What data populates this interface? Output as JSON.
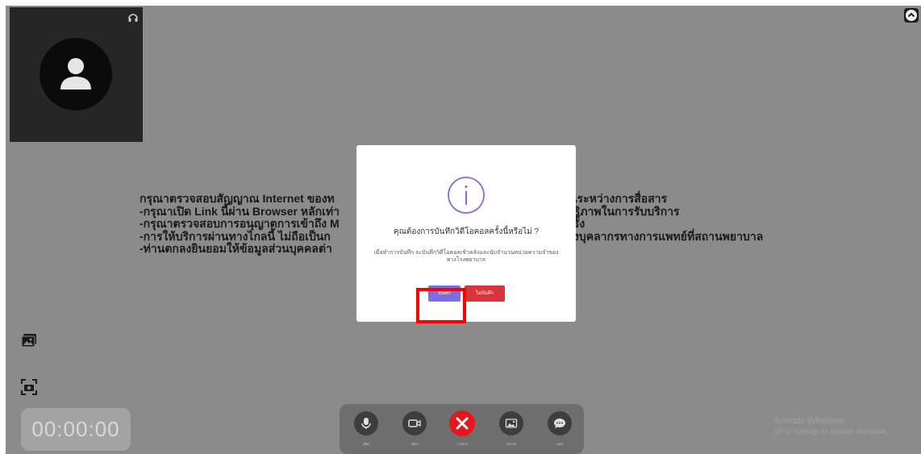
{
  "notice": {
    "lines": [
      "กรุณาตรวจสอบสัญญาณ Internet ของท",
      "-กรุณาเปิด Link นี้ผ่าน Browser หลักเท่า",
      "-กรุณาตรวจสอบการอนุญาตการเข้าถึง M",
      "-การให้บริการผ่านทางไกลนี้ ไม่ถือเป็นก",
      "-ท่านตกลงยินยอมให้ข้อมูลส่วนบุคคลต่า"
    ],
    "right_lines": [
      "เจนระหว่างการสื่อสาร",
      "สิทธิภาพในการรับบริการ",
      "ุกครั้ง",
      "ของบุคลากรทางการแพทย์ที่สถานพยาบาล",
      ""
    ]
  },
  "timer": "00:00:00",
  "toolbar": {
    "buttons": [
      {
        "label": "เสียง",
        "icon": "microphone-icon"
      },
      {
        "label": "กล้อง",
        "icon": "video-camera-icon"
      },
      {
        "label": "วางสาย",
        "icon": "end-call-icon"
      },
      {
        "label": "ส่งภาพ",
        "icon": "image-icon"
      },
      {
        "label": "แชท",
        "icon": "chat-icon"
      }
    ]
  },
  "watermark": {
    "line1": "Activate Windows",
    "line2": "Go to Settings to activate Windows."
  },
  "modal": {
    "title": "คุณต้องการบันทึกวิดีโอคอลครั้งนี้หรือไม่ ?",
    "text": "เมื่อทำการบันทึก จะบันทึกวิดีโอคอลเข้าคลังและนับจำนวนหน่วยความจำของทางโรงพยาบาล",
    "confirm_label": "บันทึก",
    "cancel_label": "ไม่บันทึก"
  },
  "colors": {
    "confirm": "#7c6ee0",
    "cancel": "#d9343c",
    "end_call": "#e4161e",
    "highlight": "#ff0000",
    "info": "#8a6be0"
  }
}
